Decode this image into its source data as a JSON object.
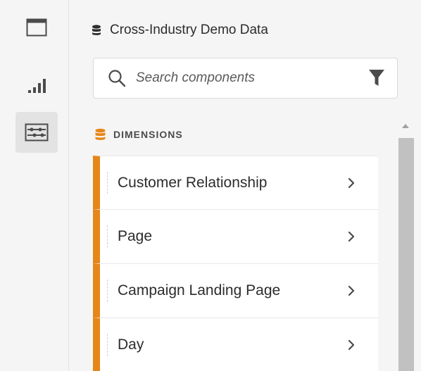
{
  "rail": {
    "items": [
      {
        "icon": "panel-icon",
        "active": false
      },
      {
        "icon": "bar-chart-icon",
        "active": false
      },
      {
        "icon": "components-icon",
        "active": true
      }
    ]
  },
  "panel": {
    "data_source": {
      "icon": "database-icon",
      "label": "Cross-Industry Demo Data"
    },
    "search": {
      "placeholder": "Search components",
      "icon": "search-icon",
      "filter_icon": "filter-icon"
    },
    "section": {
      "icon": "dimensions-icon",
      "label": "DIMENSIONS",
      "accent": "#e68619"
    },
    "dimensions": [
      {
        "label": "Customer Relationship"
      },
      {
        "label": "Page"
      },
      {
        "label": "Campaign Landing Page"
      },
      {
        "label": "Day"
      }
    ]
  }
}
